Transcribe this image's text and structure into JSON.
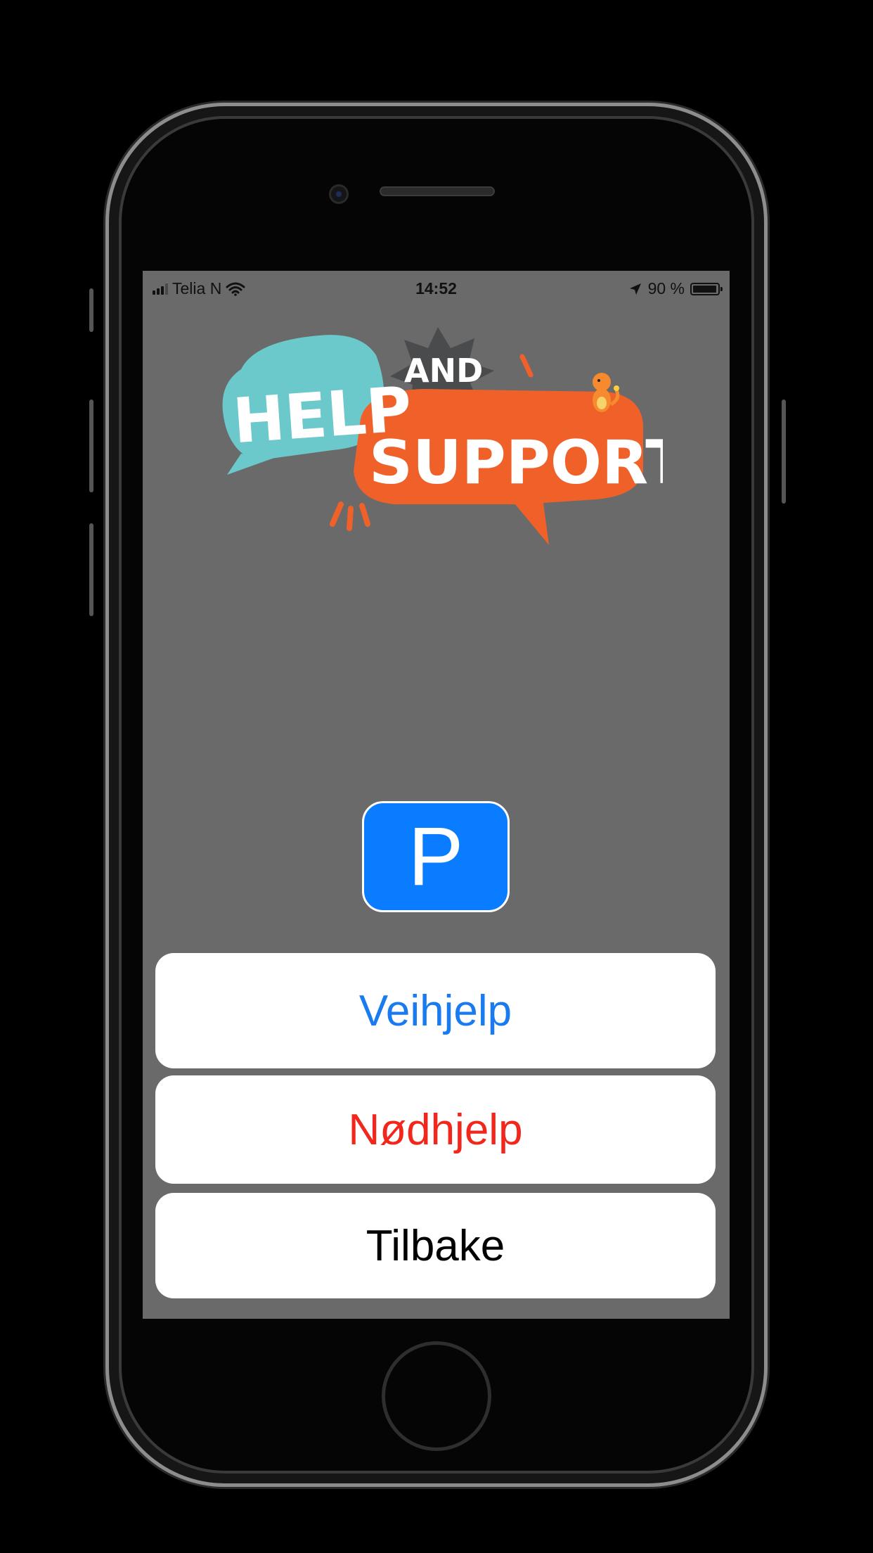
{
  "status_bar": {
    "carrier": "Telia N",
    "time": "14:52",
    "battery_text": "90 %",
    "battery_level": 0.9,
    "wifi_icon": "wifi-icon",
    "location_icon": "location-arrow-icon"
  },
  "logo": {
    "text_help": "HELP",
    "text_and": "AND",
    "text_support": "SUPPORT",
    "colors": {
      "teal": "#6cc9cb",
      "orange": "#f0612a",
      "gray": "#4a4b4d"
    }
  },
  "parking_button": {
    "label": "P",
    "color": "#0a7cff"
  },
  "action_sheet": {
    "veihjelp": {
      "label": "Veihjelp",
      "color": "#1a7bf0"
    },
    "nodhjelp": {
      "label": "Nødhjelp",
      "color": "#f2261b"
    },
    "tilbake": {
      "label": "Tilbake",
      "color": "#000000"
    }
  },
  "colors": {
    "screen_background": "#6a6a6a",
    "device_frame": "#050505"
  }
}
